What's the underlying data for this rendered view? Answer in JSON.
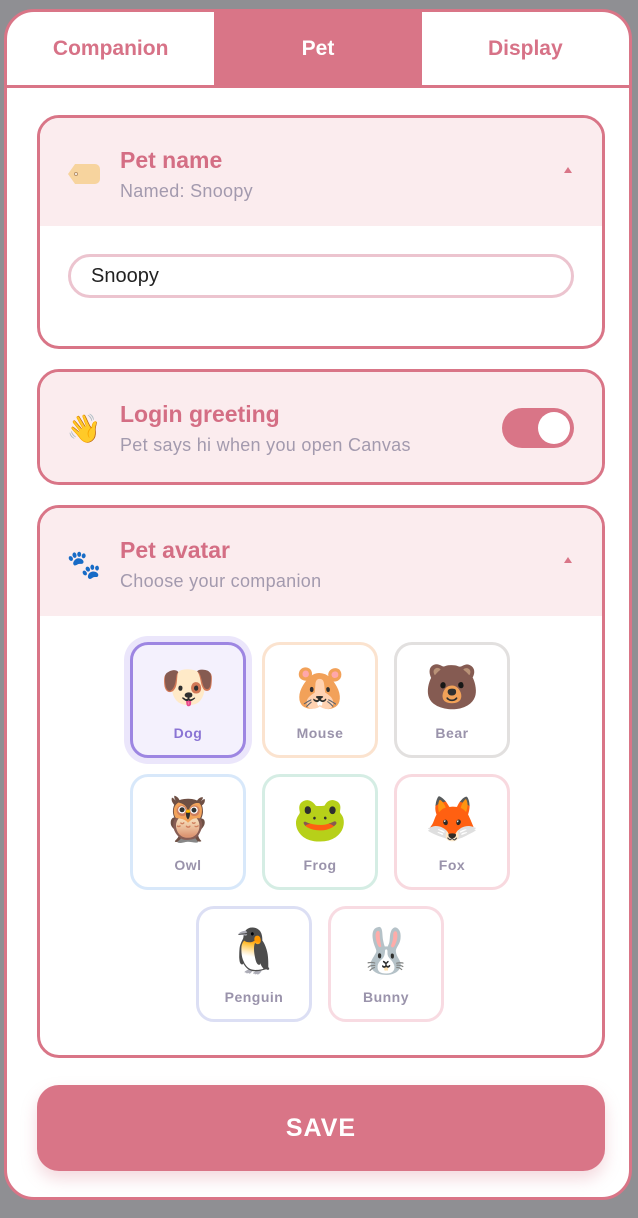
{
  "tabs": [
    {
      "label": "Companion",
      "active": false
    },
    {
      "label": "Pet",
      "active": true
    },
    {
      "label": "Display",
      "active": false
    }
  ],
  "pet_name": {
    "title": "Pet name",
    "subtitle": "Named: Snoopy",
    "icon": "tag-icon",
    "input_value": "Snoopy",
    "expanded": true
  },
  "login_greeting": {
    "title": "Login greeting",
    "subtitle": "Pet says hi when you open Canvas",
    "icon": "waving-hand-icon",
    "icon_glyph": "👋",
    "enabled": true
  },
  "pet_avatar": {
    "title": "Pet avatar",
    "subtitle": "Choose your companion",
    "icon": "paw-prints-icon",
    "icon_glyph": "🐾",
    "expanded": true,
    "options": [
      {
        "label": "Dog",
        "emoji": "🐶",
        "border": "#9d86e2",
        "selected": true
      },
      {
        "label": "Mouse",
        "emoji": "🐹",
        "border": "#fbe3cf",
        "selected": false
      },
      {
        "label": "Bear",
        "emoji": "🐻",
        "border": "#e2e0df",
        "selected": false
      },
      {
        "label": "Owl",
        "emoji": "🦉",
        "border": "#d8e8fa",
        "selected": false
      },
      {
        "label": "Frog",
        "emoji": "🐸",
        "border": "#d5ede4",
        "selected": false
      },
      {
        "label": "Fox",
        "emoji": "🦊",
        "border": "#f8d9df",
        "selected": false
      },
      {
        "label": "Penguin",
        "emoji": "🐧",
        "border": "#dcdff4",
        "selected": false
      },
      {
        "label": "Bunny",
        "emoji": "🐰",
        "border": "#f8dbe2",
        "selected": false
      }
    ]
  },
  "save_label": "SAVE",
  "colors": {
    "accent": "#d97587",
    "header_bg": "#fbecee",
    "subtitle": "#a39aae",
    "selected": "#9d86e2"
  }
}
